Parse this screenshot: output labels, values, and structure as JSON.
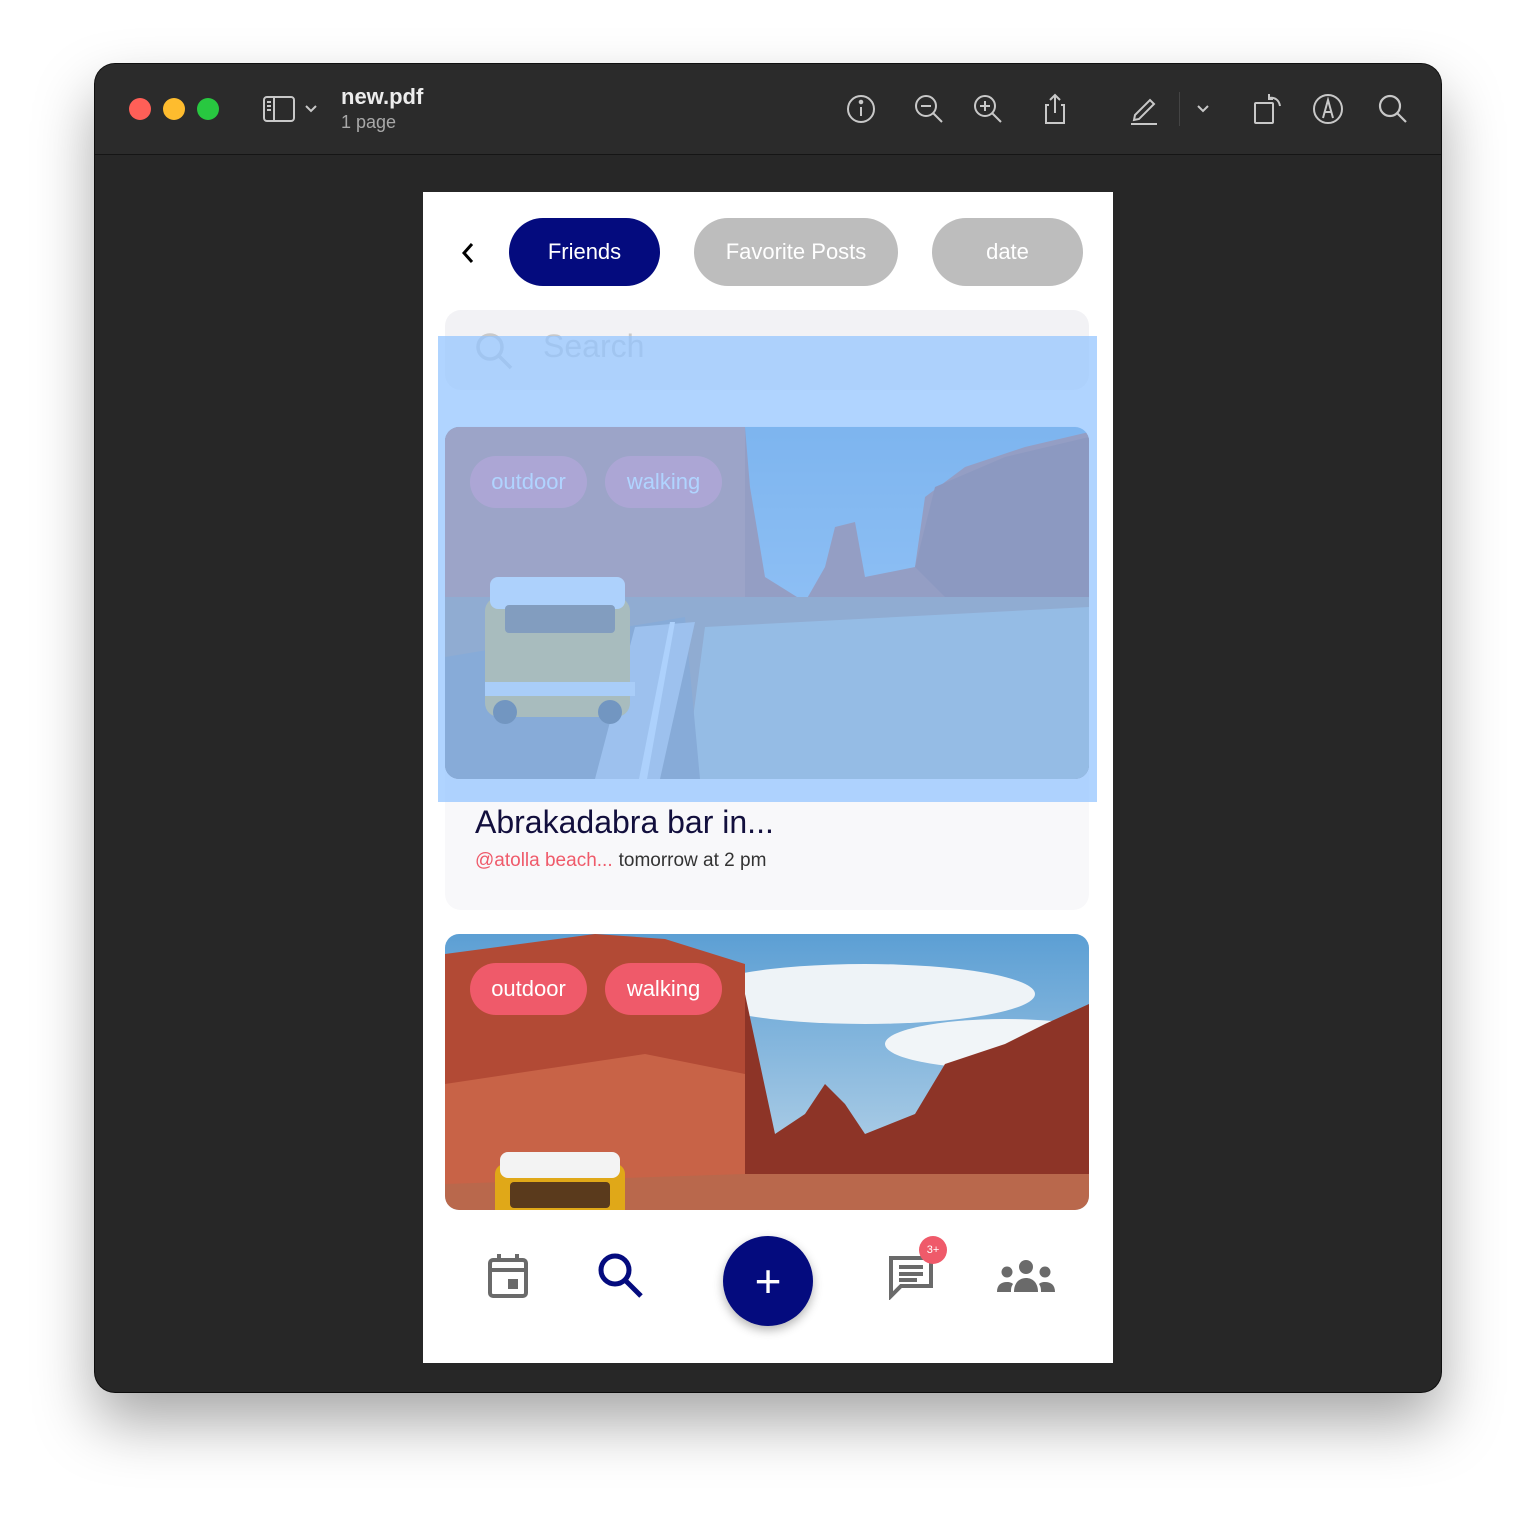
{
  "viewer": {
    "file_name": "new.pdf",
    "page_count": "1 page",
    "toolbar_icons": [
      "sidebar-icon",
      "chevron-down-icon",
      "info-icon",
      "zoom-out-icon",
      "zoom-in-icon",
      "share-icon",
      "highlight-icon",
      "chevron-down-icon",
      "rotate-icon",
      "markup-icon",
      "search-icon"
    ]
  },
  "app": {
    "filters": {
      "friends": "Friends",
      "favorite_posts": "Favorite Posts",
      "date": "date"
    },
    "search": {
      "placeholder": "Search"
    },
    "posts": [
      {
        "tags": [
          "outdoor",
          "walking"
        ],
        "title": "Abrakadabra bar in...",
        "handle": "@atolla beach...",
        "when": "tomorrow at 2 pm"
      },
      {
        "tags": [
          "outdoor",
          "walking"
        ]
      }
    ],
    "nav": {
      "items": [
        "calendar-icon",
        "search-icon",
        "add-button",
        "messages-icon",
        "group-icon"
      ],
      "fab_label": "+",
      "message_badge": "3+"
    },
    "colors": {
      "primary": "#040b7e",
      "tag": "#ef5a6a",
      "inactive_pill": "#bdbdbd",
      "selection": "#91c3ff"
    }
  }
}
